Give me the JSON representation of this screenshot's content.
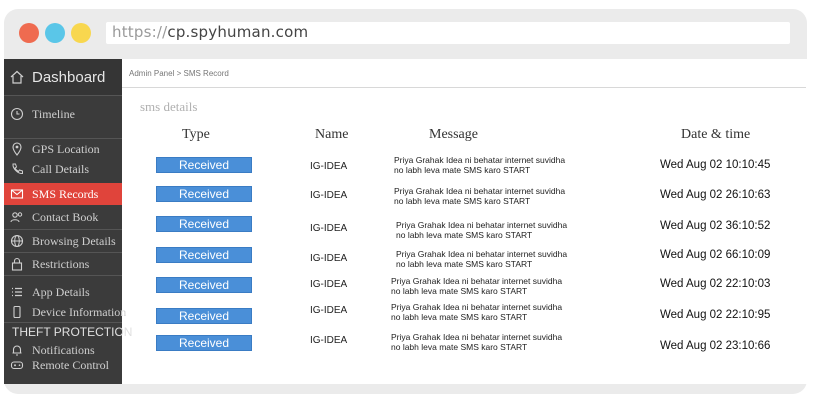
{
  "browser": {
    "url_protocol": "https://",
    "url_host": "cp.spyhuman.com"
  },
  "sidebar": {
    "dashboard": "Dashboard",
    "items": [
      {
        "label": "Timeline"
      },
      {
        "label": "GPS Location"
      },
      {
        "label": "Call Details"
      },
      {
        "label": "SMS Records"
      },
      {
        "label": "Contact Book"
      },
      {
        "label": "Browsing Details"
      },
      {
        "label": "Restrictions"
      },
      {
        "label": "App Details"
      },
      {
        "label": "Device Information"
      },
      {
        "label": "Notifications"
      },
      {
        "label": "Remote Control"
      }
    ],
    "section_theft": "THEFT PROTECTION"
  },
  "breadcrumb": "Admin Panel > SMS Record",
  "page_title": "sms details",
  "table": {
    "headers": [
      "Type",
      "Name",
      "Message",
      "Date & time"
    ],
    "rows": [
      {
        "type": "Received",
        "name": "IG-IDEA",
        "msg1": "Priya Grahak Idea ni behatar internet suvidha",
        "msg2": "no labh leva mate SMS karo START",
        "date": "Wed Aug 02 10:10:45"
      },
      {
        "type": "Received",
        "name": "IG-IDEA",
        "msg1": "Priya Grahak Idea ni behatar internet suvidha",
        "msg2": "no labh leva mate SMS karo START",
        "date": "Wed Aug 02 26:10:63"
      },
      {
        "type": "Received",
        "name": "IG-IDEA",
        "msg1": "Priya Grahak Idea ni behatar internet suvidha",
        "msg2": "no labh leva mate SMS karo START",
        "date": "Wed Aug 02 36:10:52"
      },
      {
        "type": "Received",
        "name": "IG-IDEA",
        "msg1": "Priya Grahak Idea ni behatar internet suvidha",
        "msg2": "no labh leva mate SMS karo START",
        "date": "Wed Aug 02 66:10:09"
      },
      {
        "type": "Received",
        "name": "IG-IDEA",
        "msg1": "Priya Grahak Idea ni behatar internet suvidha",
        "msg2": "no labh leva mate SMS karo START",
        "date": "Wed Aug 02 22:10:03"
      },
      {
        "type": "Received",
        "name": "IG-IDEA",
        "msg1": "Priya Grahak Idea ni behatar internet suvidha",
        "msg2": "no labh leva mate SMS karo START",
        "date": "Wed Aug 02 22:10:95"
      },
      {
        "type": "Received",
        "name": "IG-IDEA",
        "msg1": "Priya Grahak Idea ni behatar internet suvidha",
        "msg2": "no labh leva mate SMS karo START",
        "date": "Wed Aug 02 23:10:66"
      }
    ]
  },
  "colors": {
    "accent_red": "#e0443b",
    "badge_blue": "#4a8fd8",
    "sidebar_bg": "#3b3b3b"
  }
}
